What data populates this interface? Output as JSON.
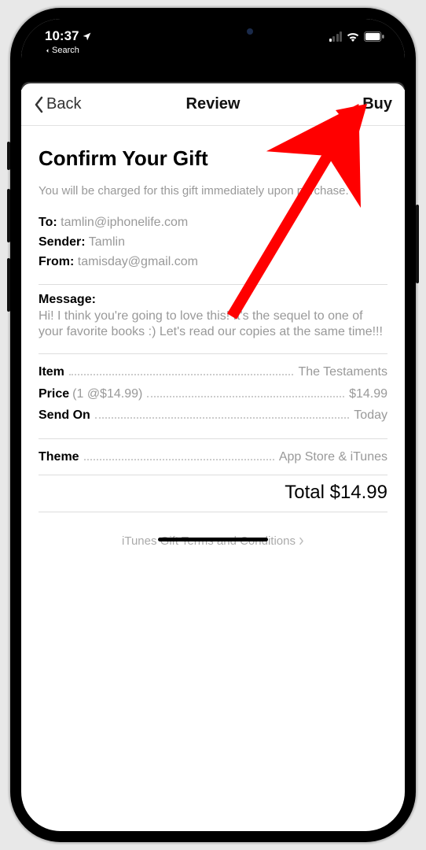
{
  "status": {
    "time": "10:37",
    "breadcrumb": "Search"
  },
  "nav": {
    "back": "Back",
    "title": "Review",
    "buy": "Buy"
  },
  "page": {
    "title": "Confirm Your Gift",
    "notice": "You will be charged for this gift immediately upon purchase."
  },
  "fields": {
    "to_label": "To:",
    "to_value": "tamlin@iphonelife.com",
    "sender_label": "Sender:",
    "sender_value": "Tamlin",
    "from_label": "From:",
    "from_value": "tamisday@gmail.com"
  },
  "message": {
    "label": "Message:",
    "body": "Hi! I think you're going to love this! It's the sequel to one of your favorite books :) Let's read our copies at the same time!!!"
  },
  "details": {
    "item_label": "Item",
    "item_value": "The Testaments",
    "price_label": "Price",
    "price_sub": "(1 @$14.99)",
    "price_value": "$14.99",
    "sendon_label": "Send On",
    "sendon_value": "Today",
    "theme_label": "Theme",
    "theme_value": "App Store & iTunes"
  },
  "total": {
    "label": "Total",
    "value": "$14.99"
  },
  "terms": "iTunes Gift Terms and Conditions"
}
